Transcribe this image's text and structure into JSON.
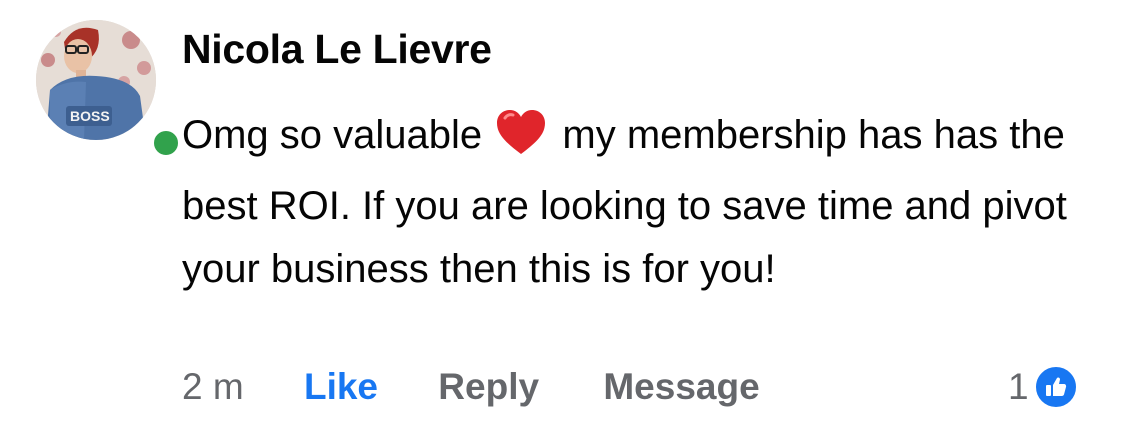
{
  "comment": {
    "author": "Nicola Le Lievre",
    "text_before_emoji": "Omg so valuable",
    "emoji": "red-heart",
    "text_after_emoji": "my membership has has the best ROI. If you are looking to save time and pivot your business then this is for you!",
    "online_status_color": "#31a24c",
    "avatar_jacket_text": "BOSS"
  },
  "actions": {
    "time": "2 m",
    "like_label": "Like",
    "reply_label": "Reply",
    "message_label": "Message"
  },
  "reactions": {
    "count": "1",
    "type": "like-icon",
    "color": "#1877f2"
  }
}
